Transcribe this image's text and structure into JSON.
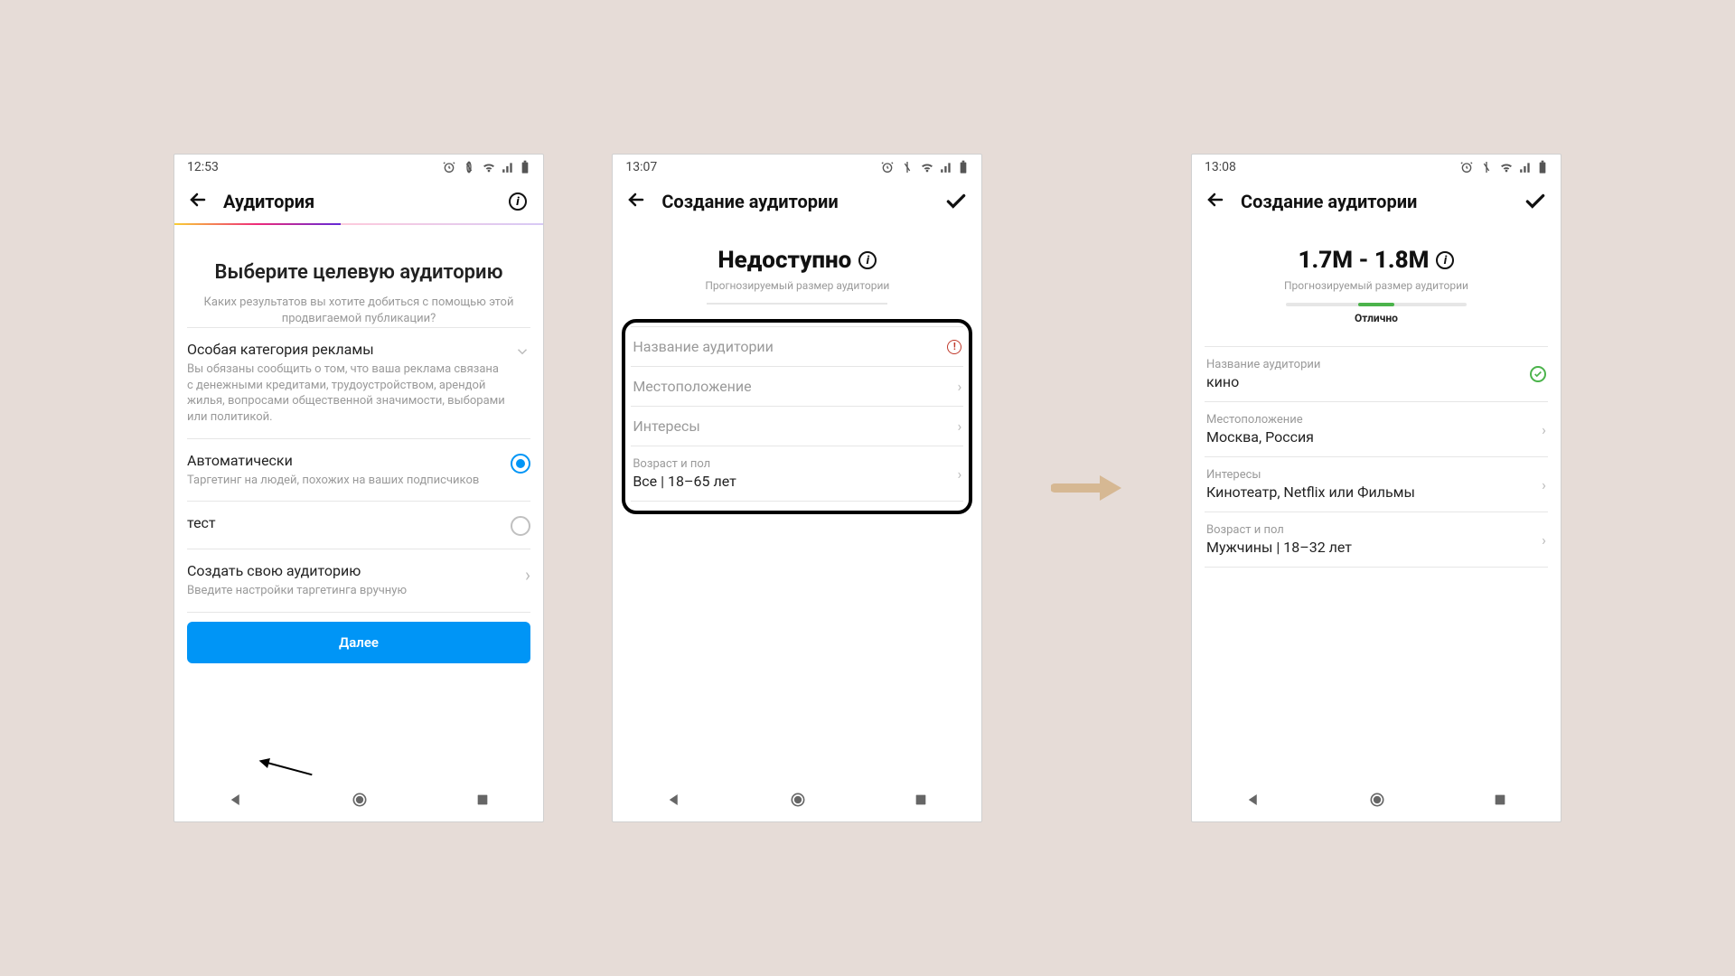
{
  "screens": [
    {
      "time": "12:53",
      "header": {
        "title": "Аудитория",
        "right": "info"
      },
      "heading": "Выберите целевую аудиторию",
      "subheading": "Каких результатов вы хотите добиться с помощью этой продвигаемой публикации?",
      "special": {
        "label": "Особая категория рекламы",
        "desc": "Вы обязаны сообщить о том, что ваша реклама связана с денежными кредитами, трудоустройством, арендой жилья, вопросами общественной значимости, выборами или политикой."
      },
      "options": [
        {
          "label": "Автоматически",
          "desc": "Таргетинг на людей, похожих на ваших подписчиков",
          "selected": true
        },
        {
          "label": "тест",
          "desc": "",
          "selected": false
        }
      ],
      "create": {
        "label": "Создать свою аудиторию",
        "desc": "Введите настройки таргетинга вручную"
      },
      "primary": "Далее"
    },
    {
      "time": "13:07",
      "header": {
        "title": "Создание аудитории",
        "right": "check"
      },
      "reach": {
        "title": "Недоступно",
        "sub": "Прогнозируемый размер аудитории"
      },
      "rows": [
        {
          "label": "Название аудитории",
          "value": "",
          "icon": "warn"
        },
        {
          "label": "Местоположение",
          "value": "",
          "icon": "chev"
        },
        {
          "label": "Интересы",
          "value": "",
          "icon": "chev"
        },
        {
          "label": "Возраст и пол",
          "value": "Все | 18–65 лет",
          "icon": "chev"
        }
      ]
    },
    {
      "time": "13:08",
      "header": {
        "title": "Создание аудитории",
        "right": "check"
      },
      "reach": {
        "title": "1.7M - 1.8M",
        "sub": "Прогнозируемый размер аудитории",
        "status": "Отлично"
      },
      "rows": [
        {
          "label": "Название аудитории",
          "value": "кино",
          "icon": "ok"
        },
        {
          "label": "Местоположение",
          "value": "Москва, Россия",
          "icon": "chev"
        },
        {
          "label": "Интересы",
          "value": "Кинотеатр, Netflix или Фильмы",
          "icon": "chev"
        },
        {
          "label": "Возраст и пол",
          "value": "Мужчины | 18–32 лет",
          "icon": "chev"
        }
      ]
    }
  ]
}
